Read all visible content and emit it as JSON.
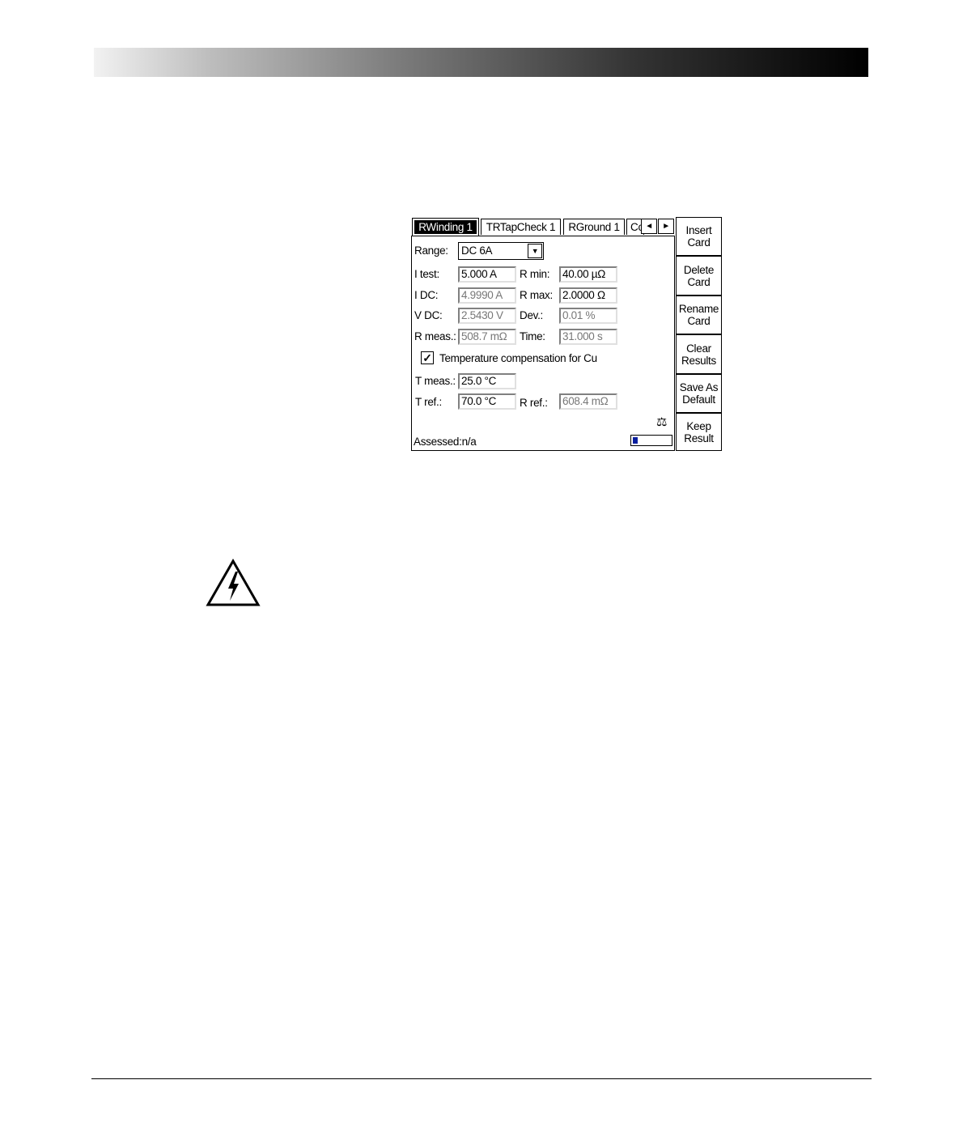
{
  "tabs": [
    {
      "label": "RWinding 1",
      "active": true
    },
    {
      "label": "TRTapCheck 1",
      "active": false
    },
    {
      "label": "RGround 1",
      "active": false
    },
    {
      "label": "Co",
      "active": false
    }
  ],
  "tab_arrows": {
    "left": "◄",
    "right": "►"
  },
  "range": {
    "label": "Range:",
    "value": "DC 6A"
  },
  "fields": {
    "i_test": {
      "label": "I test:",
      "value": "5.000 A"
    },
    "i_dc": {
      "label": "I DC:",
      "value": "4.9990 A"
    },
    "v_dc": {
      "label": "V DC:",
      "value": "2.5430 V"
    },
    "r_meas": {
      "label": "R meas.:",
      "value": "508.7 mΩ"
    },
    "r_min": {
      "label": "R min:",
      "value": "40.00 µΩ"
    },
    "r_max": {
      "label": "R max:",
      "value": "2.0000 Ω"
    },
    "dev": {
      "label": "Dev.:",
      "value": "0.01 %"
    },
    "time": {
      "label": "Time:",
      "value": "31.000 s"
    },
    "t_meas": {
      "label": "T meas.:",
      "value": "25.0 °C"
    },
    "t_ref": {
      "label": "T ref.:",
      "value": "70.0 °C"
    },
    "r_ref": {
      "label": "R ref.:",
      "value": "608.4 mΩ"
    }
  },
  "temp_comp": {
    "label": "Temperature compensation for Cu",
    "checked": true,
    "mark": "✓"
  },
  "status": {
    "assessed": "Assessed:n/a",
    "scale_glyph": "⚖",
    "progress": 0.12
  },
  "softkeys": [
    "Insert\nCard",
    "Delete\nCard",
    "Rename\nCard",
    "Clear\nResults",
    "Save As\nDefault",
    "Keep\nResult"
  ],
  "colors": {
    "progress_fill": "#0a1f9e",
    "header_gradient_end": "#000000"
  },
  "icons": {
    "warning": "high-voltage-warning-icon"
  }
}
